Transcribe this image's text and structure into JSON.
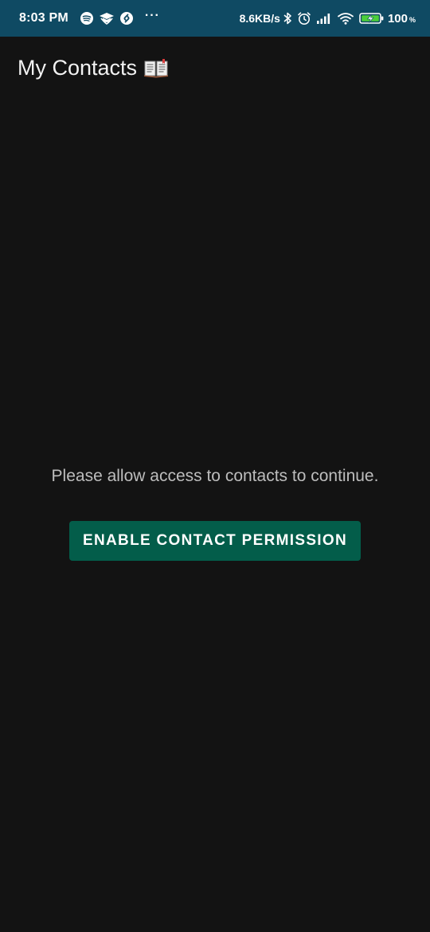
{
  "status_bar": {
    "time": "8:03 PM",
    "dots": "···",
    "network_speed": "8.6KB/s",
    "battery_percent": "100",
    "percent_sign": "%",
    "bg_color": "#0f4a63",
    "icons": [
      "spotify-icon",
      "mortarboard-icon",
      "shazam-icon",
      "bluetooth-icon",
      "alarm-icon",
      "signal-icon",
      "wifi-icon",
      "battery-charging-icon"
    ]
  },
  "app_bar": {
    "title": "My Contacts",
    "title_icon": "open-book-icon"
  },
  "main": {
    "message": "Please allow access to contacts to continue.",
    "button_label": "ENABLE CONTACT PERMISSION",
    "button_color": "#035d4a"
  },
  "colors": {
    "background": "#131313",
    "message_text": "#bdbdbd"
  }
}
